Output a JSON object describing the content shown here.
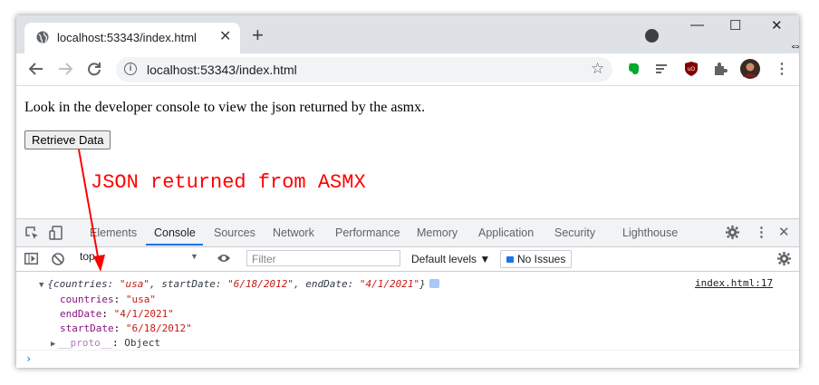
{
  "browser": {
    "tab_title": "localhost:53343/index.html",
    "tab_close": "✕",
    "new_tab": "+",
    "url": "localhost:53343/index.html",
    "window_controls": {
      "minimize": "—",
      "maximize": "☐",
      "close": "✕"
    }
  },
  "page": {
    "instruction": "Look in the developer console to view the json returned by the asmx.",
    "button_label": "Retrieve Data",
    "annotation": "JSON returned from ASMX",
    "annotation_color": "#ff0000"
  },
  "devtools": {
    "tabs": [
      "Elements",
      "Console",
      "Sources",
      "Network",
      "Performance",
      "Memory",
      "Application",
      "Security",
      "Lighthouse"
    ],
    "active_tab": "Console",
    "context": "top",
    "filter_placeholder": "Filter",
    "levels": "Default levels ▼",
    "no_issues": "No Issues",
    "source_link": "index.html:17",
    "summary": {
      "prefix": "{countries: ",
      "countries": "\"usa\"",
      "mid1": ", startDate: ",
      "startDate": "\"6/18/2012\"",
      "mid2": ", endDate: ",
      "endDate": "\"4/1/2021\"",
      "suffix": "}"
    },
    "properties": [
      {
        "key": "countries",
        "value": "\"usa\""
      },
      {
        "key": "endDate",
        "value": "\"4/1/2021\""
      },
      {
        "key": "startDate",
        "value": "\"6/18/2012\""
      }
    ],
    "proto": {
      "key": "__proto__",
      "value": "Object"
    },
    "prompt": "›"
  },
  "colors": {
    "accent": "#1a73e8",
    "string": "#c41a16",
    "key": "#881280"
  }
}
